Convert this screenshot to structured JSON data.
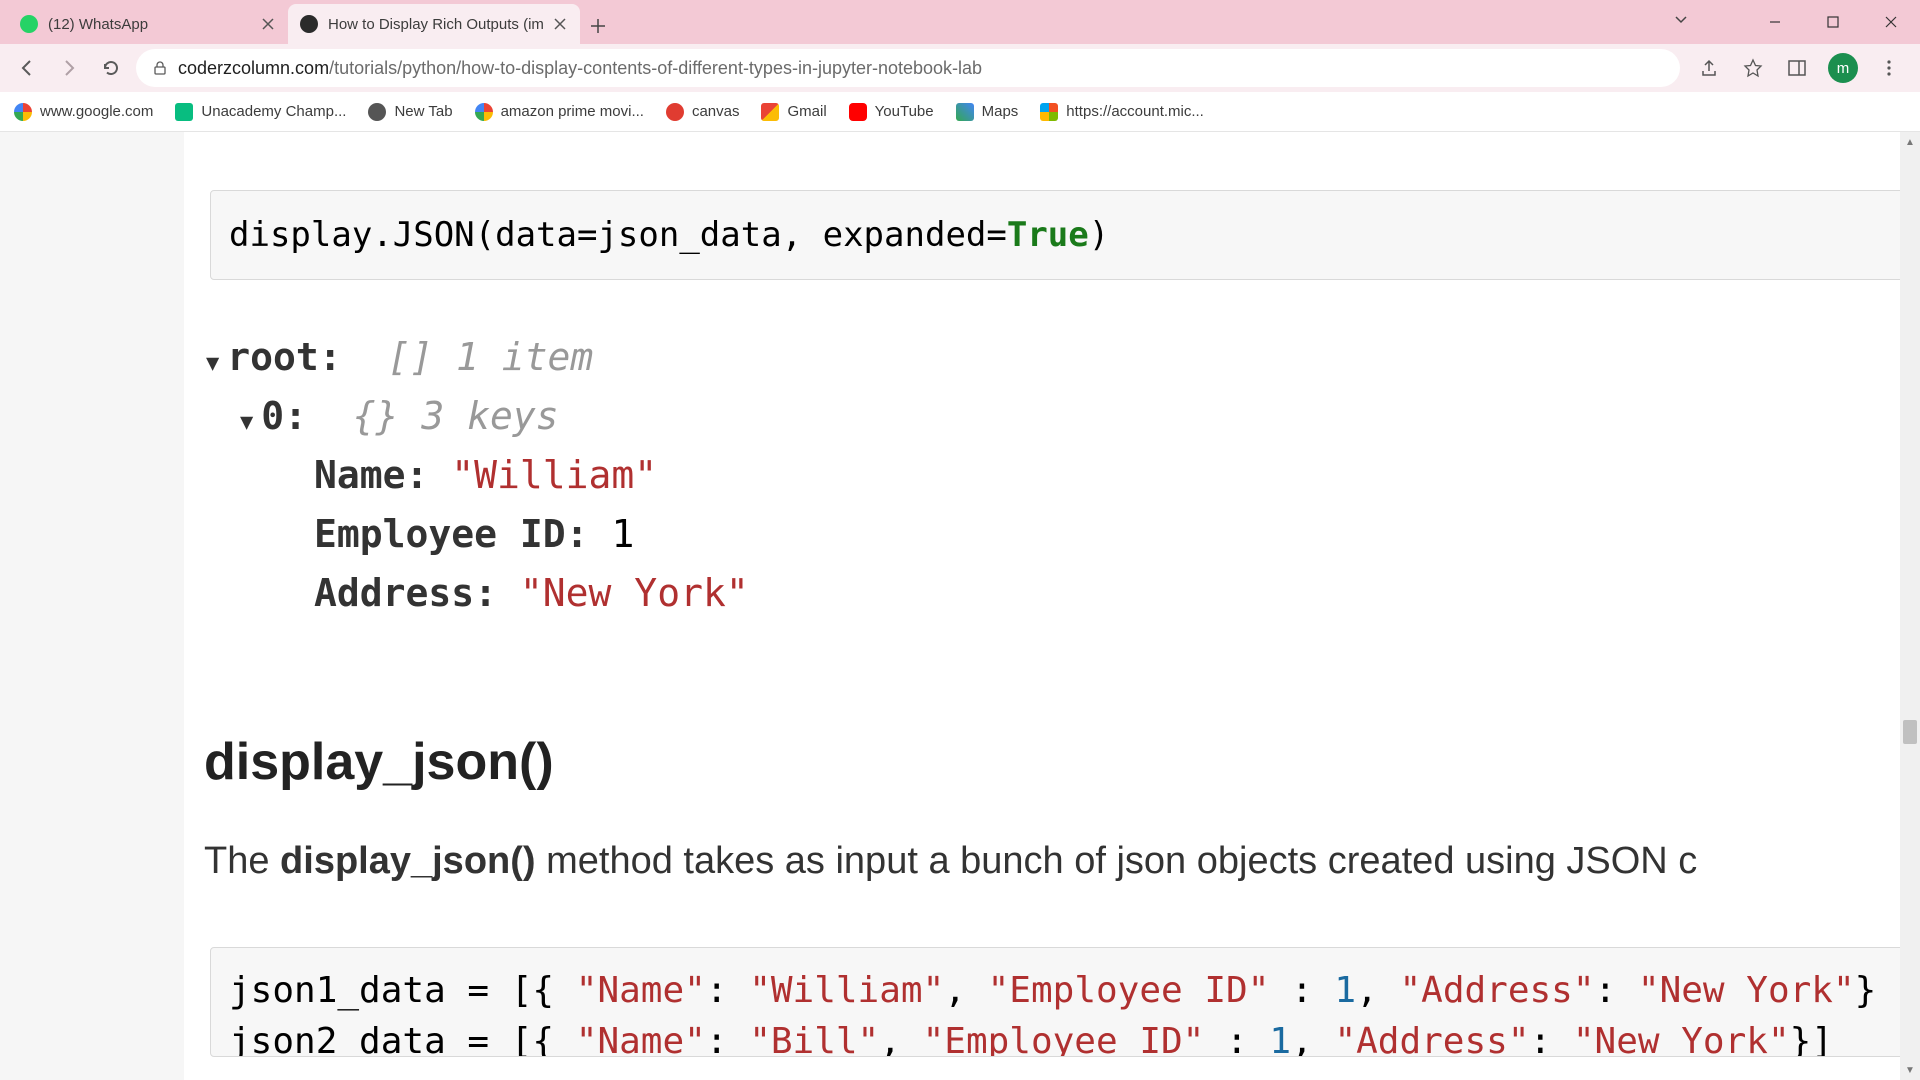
{
  "tabs": [
    {
      "title": "(12) WhatsApp",
      "favicon_color": "#25d366"
    },
    {
      "title": "How to Display Rich Outputs (im",
      "favicon_color": "#2b2b2b"
    }
  ],
  "address": {
    "domain": "coderzcolumn.com",
    "path": "/tutorials/python/how-to-display-contents-of-different-types-in-jupyter-notebook-lab"
  },
  "bookmarks": [
    {
      "label": "www.google.com",
      "icon": "google"
    },
    {
      "label": "Unacademy Champ...",
      "icon": "unacademy"
    },
    {
      "label": "New Tab",
      "icon": "globe"
    },
    {
      "label": "amazon prime movi...",
      "icon": "google"
    },
    {
      "label": "canvas",
      "icon": "canvas"
    },
    {
      "label": "Gmail",
      "icon": "gmail"
    },
    {
      "label": "YouTube",
      "icon": "youtube"
    },
    {
      "label": "Maps",
      "icon": "maps"
    },
    {
      "label": "https://account.mic...",
      "icon": "microsoft"
    }
  ],
  "avatar_letter": "m",
  "code1": {
    "pre": "display.JSON(data=json_data, expanded=",
    "bool": "True",
    "post": ")"
  },
  "json_tree": {
    "root_key": "root:",
    "root_meta": "[] 1 item",
    "idx_key": "0:",
    "idx_meta": "{} 3 keys",
    "rows": [
      {
        "key": "Name:",
        "val": "\"William\""
      },
      {
        "key": "Employee ID:",
        "val": "1"
      },
      {
        "key": "Address:",
        "val": "\"New York\""
      }
    ]
  },
  "heading": "display_json()",
  "para_pre": "The ",
  "para_bold": "display_json()",
  "para_post": " method takes as input a bunch of json objects created using JSON c",
  "code2": {
    "line1_var": "json1_data = [{ ",
    "line1_k1": "\"Name\"",
    "line1_c1": ": ",
    "line1_v1": "\"William\"",
    "line1_c2": ", ",
    "line1_k2": "\"Employee ID\"",
    "line1_c3": " : ",
    "line1_v2": "1",
    "line1_c4": ", ",
    "line1_k3": "\"Address\"",
    "line1_c5": ": ",
    "line1_v3": "\"New York\"",
    "line1_end": "}",
    "line2_var": "json2_data = [{ ",
    "line2_k1": "\"Name\"",
    "line2_c1": ": ",
    "line2_v1": "\"Bill\"",
    "line2_c2": ", ",
    "line2_k2": "\"Employee ID\"",
    "line2_c3": " : ",
    "line2_v2": "1",
    "line2_c4": ", ",
    "line2_k3": "\"Address\"",
    "line2_c5": ": ",
    "line2_v3": "\"New York\"",
    "line2_end": "}]"
  }
}
